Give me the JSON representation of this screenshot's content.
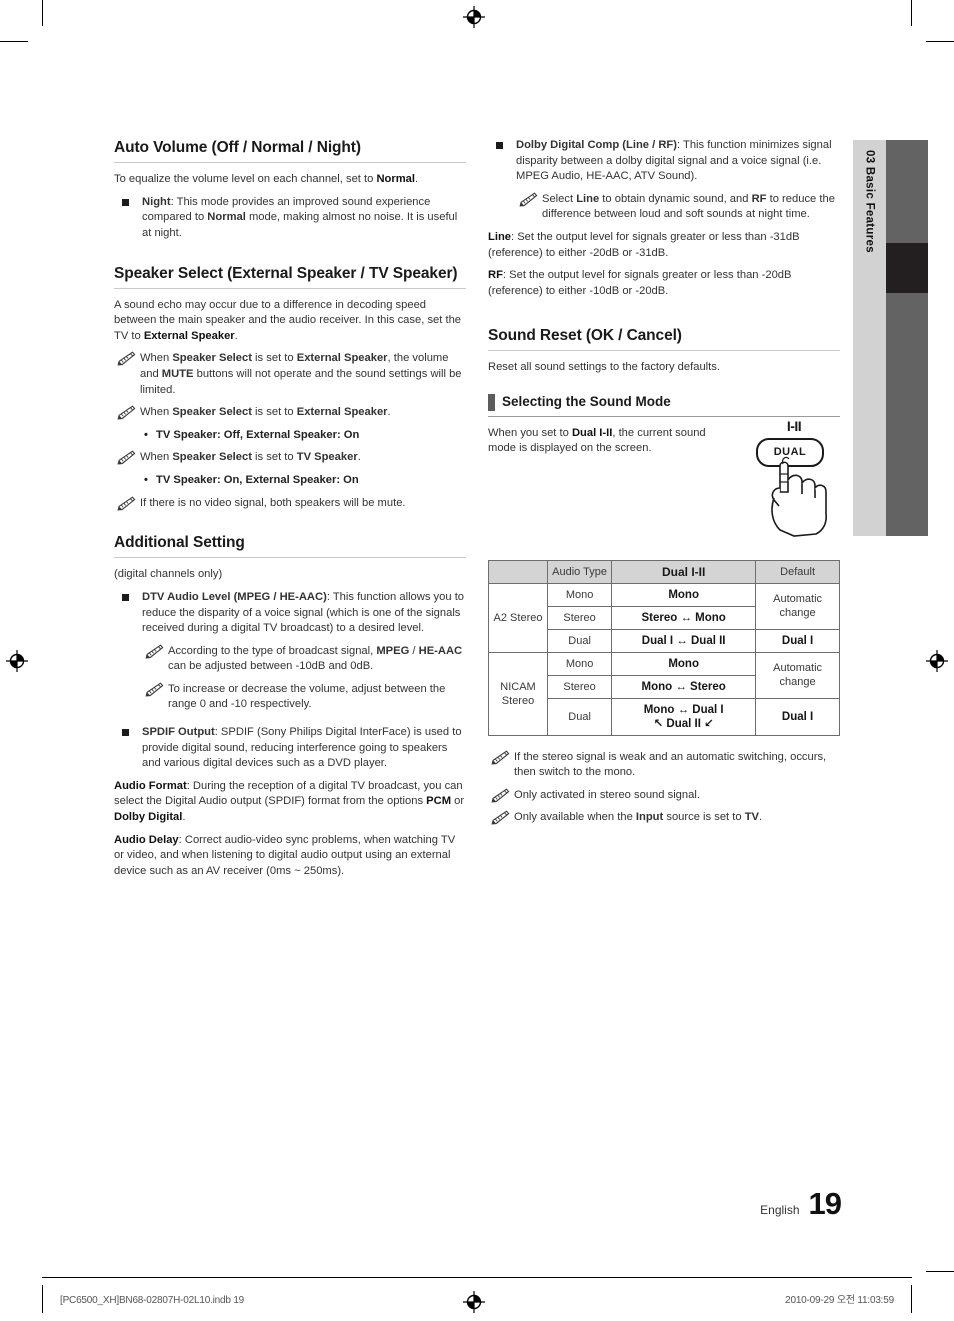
{
  "page": {
    "language": "English",
    "number": "19",
    "side_tab": {
      "chapter": "03",
      "title": "Basic Features",
      "combined": "03   Basic Features"
    },
    "footer": {
      "file": "[PC6500_XH]BN68-02807H-02L10.indb   19",
      "timestamp": "2010-09-29   오전 11:03:59"
    }
  },
  "left_column": {
    "auto_volume": {
      "heading": "Auto Volume (Off / Normal / Night)",
      "intro_a": "To equalize the volume level on each channel, set to ",
      "intro_b": "Normal",
      "intro_c": ".",
      "bullet": {
        "term": "Night",
        "text_a": ": This mode provides an improved sound experience compared to ",
        "term2": "Normal",
        "text_b": " mode, making almost no noise. It is useful at night."
      }
    },
    "speaker_select": {
      "heading": "Speaker Select (External Speaker / TV Speaker)",
      "intro_a": "A sound echo may occur due to a difference in decoding speed between the main speaker and the audio receiver. In this case, set the TV to ",
      "intro_b": "External Speaker",
      "intro_c": ".",
      "note1": {
        "a": "When ",
        "b": "Speaker Select",
        "c": " is set to ",
        "d": "External Speaker",
        "e": ", the volume and ",
        "f": "MUTE",
        "g": " buttons will not operate and the sound settings will be limited."
      },
      "note2": {
        "a": "When ",
        "b": "Speaker Select",
        "c": " is set to ",
        "d": "External Speaker",
        "e": "."
      },
      "dot2": "TV Speaker: Off, External Speaker: On",
      "note3": {
        "a": "When ",
        "b": "Speaker Select",
        "c": " is set to ",
        "d": "TV Speaker",
        "e": "."
      },
      "dot3": "TV Speaker: On, External Speaker: On",
      "note4": "If there is no video signal, both speakers will be mute."
    },
    "additional_setting": {
      "heading": "Additional Setting",
      "subtitle": "(digital channels only)",
      "dtv": {
        "term": "DTV Audio Level (MPEG / HE-AAC)",
        "text": ": This function allows you to reduce the disparity of a voice signal (which is one of the signals received during a digital TV broadcast) to a desired level.",
        "note1": {
          "a": "According to the type of broadcast signal, ",
          "b": "MPEG",
          "c": " / ",
          "d": "HE-AAC",
          "e": " can be adjusted between -10dB and 0dB."
        },
        "note2": "To increase or decrease the volume, adjust between the range 0 and -10 respectively."
      },
      "spdif": {
        "term": "SPDIF Output",
        "text": ": SPDIF (Sony Philips Digital InterFace) is used to provide digital sound, reducing interference going to speakers and various digital devices such as a DVD player.",
        "audio_format": {
          "term": "Audio Format",
          "a": ": During the reception of a digital TV broadcast, you can select the Digital Audio output (SPDIF) format from the options ",
          "b": "PCM",
          "c": " or ",
          "d": "Dolby Digital",
          "e": "."
        },
        "audio_delay": {
          "term": "Audio Delay",
          "text": ": Correct audio-video sync problems, when watching TV or video, and when listening to digital audio output using an external device such as an AV receiver (0ms ~ 250ms)."
        }
      }
    }
  },
  "right_column": {
    "dolby": {
      "term": "Dolby Digital Comp (Line / RF)",
      "text": ": This function minimizes signal disparity between a dolby digital signal and a voice signal (i.e. MPEG Audio, HE-AAC, ATV Sound).",
      "note": {
        "a": "Select ",
        "b": "Line",
        "c": " to obtain dynamic sound, and ",
        "d": "RF",
        "e": " to reduce the difference between loud and soft sounds at night time."
      },
      "line": {
        "term": "Line",
        "text": ": Set the output level for signals greater or less than -31dB (reference) to either -20dB or -31dB."
      },
      "rf": {
        "term": "RF",
        "text": ": Set the output level for signals greater or less than -20dB (reference) to either -10dB or -20dB."
      }
    },
    "sound_reset": {
      "heading": "Sound Reset (OK / Cancel)",
      "text": "Reset all sound settings to the factory defaults."
    },
    "sound_mode": {
      "heading": "Selecting the Sound Mode",
      "intro_a": "When you set to ",
      "intro_b": "Dual I-II",
      "intro_c": ", the current sound mode is displayed on the screen.",
      "remote": {
        "label_top": "I-II",
        "key": "DUAL"
      },
      "table": {
        "headers": [
          "",
          "Audio Type",
          "Dual I-II",
          "Default"
        ],
        "rows": [
          {
            "group": "A2 Stereo",
            "type": "Mono",
            "dual": "Mono",
            "default": "Automatic change"
          },
          {
            "group": "A2 Stereo",
            "type": "Stereo",
            "dual": "Stereo ↔ Mono",
            "default": "Automatic change"
          },
          {
            "group": "A2 Stereo",
            "type": "Dual",
            "dual": "Dual I ↔ Dual II",
            "default": "Dual I"
          },
          {
            "group": "NICAM Stereo",
            "type": "Mono",
            "dual": "Mono",
            "default": "Automatic change"
          },
          {
            "group": "NICAM Stereo",
            "type": "Stereo",
            "dual": "Mono ↔ Stereo",
            "default": "Automatic change"
          },
          {
            "group": "NICAM Stereo",
            "type": "Dual",
            "dual": "Mono ↔ Dual I",
            "dual2": "↖ Dual II ↙",
            "default": "Dual I"
          }
        ]
      },
      "notes": [
        "If the stereo signal is weak and an automatic switching, occurs, then switch to the mono.",
        "Only activated in stereo sound signal."
      ],
      "note3": {
        "a": "Only available when the ",
        "b": "Input",
        "c": " source is set to ",
        "d": "TV",
        "e": "."
      }
    }
  }
}
